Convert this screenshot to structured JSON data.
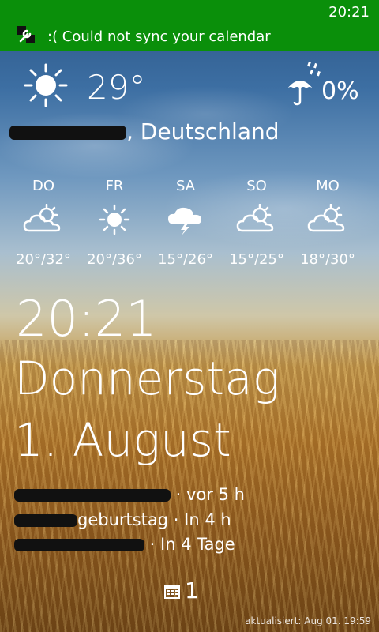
{
  "status_bar": {
    "time": "20:21"
  },
  "notification": {
    "text": ":( Could not sync your calendar",
    "icon": "wrench-icon"
  },
  "current": {
    "temperature": "29°",
    "condition_icon": "sun-icon",
    "precip_icon": "umbrella-rain-icon",
    "precip_chance": "0%",
    "location_suffix": ", Deutschland"
  },
  "forecast": [
    {
      "day": "DO",
      "icon": "cloud-sun-icon",
      "range": "20°/32°"
    },
    {
      "day": "FR",
      "icon": "sun-icon",
      "range": "20°/36°"
    },
    {
      "day": "SA",
      "icon": "thunderstorm-icon",
      "range": "15°/26°"
    },
    {
      "day": "SO",
      "icon": "cloud-sun-icon",
      "range": "15°/25°"
    },
    {
      "day": "MO",
      "icon": "cloud-sun-icon",
      "range": "18°/30°"
    }
  ],
  "clock": {
    "time": "20:21",
    "weekday": "Donnerstag",
    "date": "1. August"
  },
  "events": [
    {
      "suffix": " · vor 5 h"
    },
    {
      "suffix": "geburtstag · In 4 h"
    },
    {
      "suffix": " · In 4 Tage"
    }
  ],
  "calendar_badge": {
    "icon": "calendar-icon",
    "count": "1"
  },
  "footer": {
    "updated": "aktualisiert: Aug 01. 19:59"
  },
  "colors": {
    "notification_bar": "#0a8f0a",
    "text": "#ffffff"
  }
}
